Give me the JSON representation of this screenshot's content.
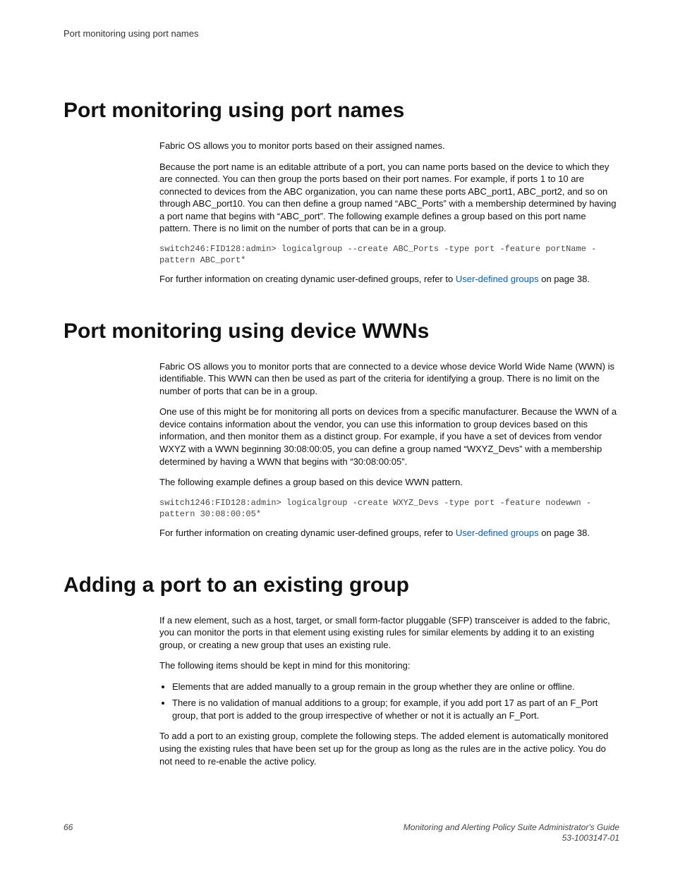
{
  "running_header": "Port monitoring using port names",
  "sections": [
    {
      "heading": "Port monitoring using port names",
      "p1": "Fabric OS allows you to monitor ports based on their assigned names.",
      "p2": "Because the port name is an editable attribute of a port, you can name ports based on the device to which they are connected. You can then group the ports based on their port names. For example, if ports 1 to 10 are connected to devices from the ABC organization, you can name these ports ABC_port1, ABC_port2, and so on through ABC_port10. You can then define a group named “ABC_Ports” with a membership determined by having a port name that begins with “ABC_port”. The following example defines a group based on this port name pattern. There is no limit on the number of ports that can be in a group.",
      "code": "switch246:FID128:admin> logicalgroup --create ABC_Ports -type port -feature portName -pattern ABC_port*",
      "p3a": "For further information on creating dynamic user-defined groups, refer to ",
      "link": "User-defined groups",
      "p3b": " on page 38."
    },
    {
      "heading": "Port monitoring using device WWNs",
      "p1": "Fabric OS allows you to monitor ports that are connected to a device whose device World Wide Name (WWN) is identifiable. This WWN can then be used as part of the criteria for identifying a group. There is no limit on the number of ports that can be in a group.",
      "p2": "One use of this might be for monitoring all ports on devices from a specific manufacturer. Because the WWN of a device contains information about the vendor, you can use this information to group devices based on this information, and then monitor them as a distinct group. For example, if you have a set of devices from vendor WXYZ with a WWN beginning 30:08:00:05, you can define a group named “WXYZ_Devs” with a membership determined by having a WWN that begins with “30:08:00:05”.",
      "p3": "The following example defines a group based on this device WWN pattern.",
      "code": "switch1246:FID128:admin> logicalgroup -create WXYZ_Devs -type port -feature nodewwn -pattern 30:08:00:05*",
      "p4a": "For further information on creating dynamic user-defined groups, refer to ",
      "link": "User-defined groups",
      "p4b": " on page 38."
    },
    {
      "heading": "Adding a port to an existing group",
      "p1": "If a new element, such as a host, target, or small form-factor pluggable (SFP) transceiver is added to the fabric, you can monitor the ports in that element using existing rules for similar elements by adding it to an existing group, or creating a new group that uses an existing rule.",
      "p2": "The following items should be kept in mind for this monitoring:",
      "b1": "Elements that are added manually to a group remain in the group whether they are online or offline.",
      "b2": "There is no validation of manual additions to a group; for example, if you add port 17 as part of an F_Port group, that port is added to the group irrespective of whether or not it is actually an F_Port.",
      "p3": "To add a port to an existing group, complete the following steps. The added element is automatically monitored using the existing rules that have been set up for the group as long as the rules are in the active policy. You do not need to re-enable the active policy."
    }
  ],
  "footer": {
    "pagenum": "66",
    "guide": "Monitoring and Alerting Policy Suite Administrator's Guide",
    "docnum": "53-1003147-01"
  }
}
